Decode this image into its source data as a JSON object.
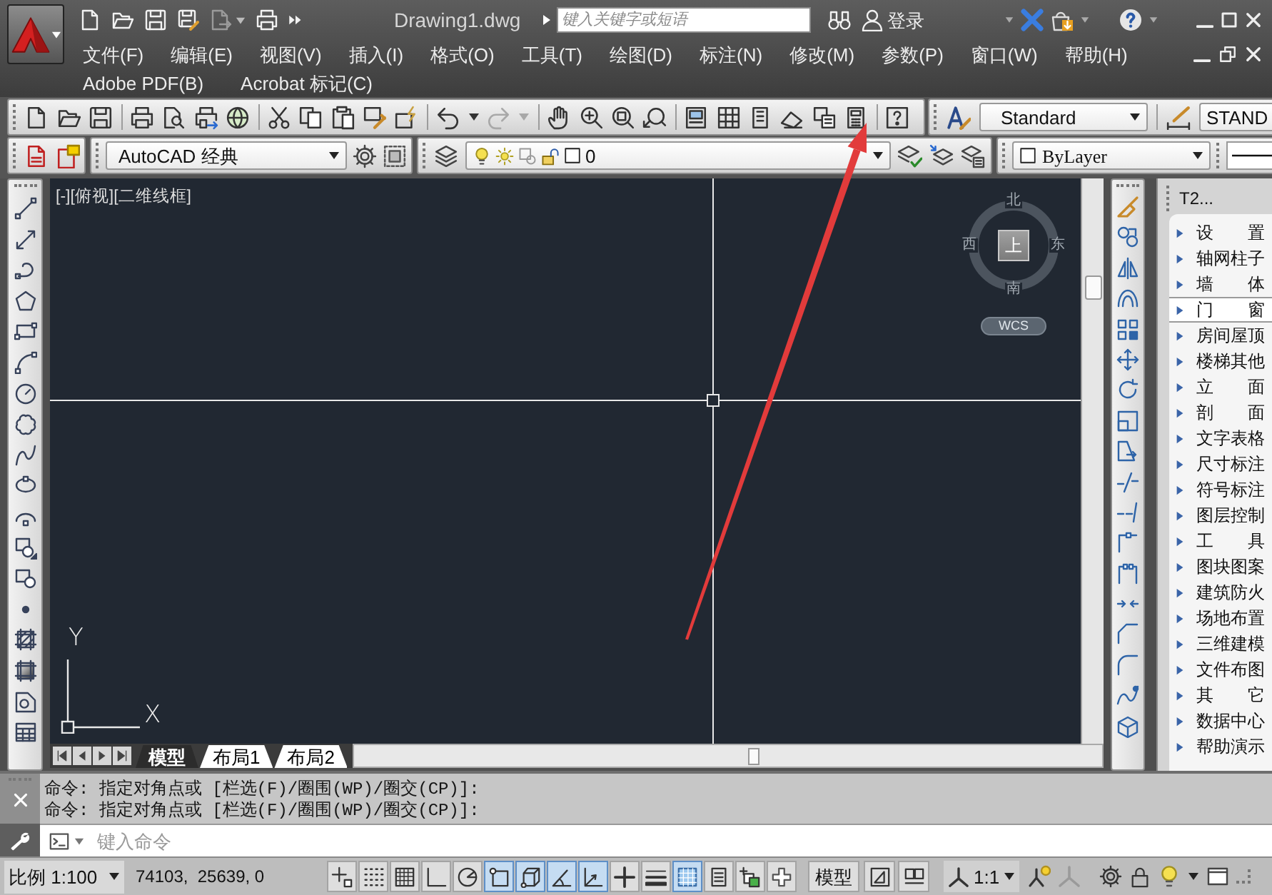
{
  "title_bar": {
    "title": "Drawing1.dwg",
    "search": {
      "placeholder": "键入关键字或短语"
    },
    "sign_in": "登录"
  },
  "menu_bar": [
    "文件(F)",
    "编辑(E)",
    "视图(V)",
    "插入(I)",
    "格式(O)",
    "工具(T)",
    "绘图(D)",
    "标注(N)",
    "修改(M)",
    "参数(P)",
    "窗口(W)",
    "帮助(H)"
  ],
  "menu_bar_2": [
    "Adobe PDF(B)",
    "Acrobat 标记(C)"
  ],
  "styles_toolbar": {
    "text_style": "Standard",
    "dimension_style": "STAND"
  },
  "workspace_toolbar": {
    "workspace": "AutoCAD 经典"
  },
  "layers_toolbar": {
    "layer": "0"
  },
  "properties_toolbar": {
    "color_dropdown": "ByLayer"
  },
  "viewport": {
    "label": "[-][俯视][二维线框]",
    "viewcube": {
      "face": "上",
      "north": "北",
      "south": "南",
      "west": "西",
      "east": "东",
      "coordinate_system": "WCS"
    },
    "ucs_icon": {
      "x_label": "X",
      "y_label": "Y"
    }
  },
  "tool_palette": {
    "title": "T2...",
    "items": [
      {
        "label": "设　　置",
        "selected": false
      },
      {
        "label": "轴网柱子",
        "selected": false
      },
      {
        "label": "墙　　体",
        "selected": false
      },
      {
        "label": "门　　窗",
        "selected": true
      },
      {
        "label": "房间屋顶",
        "selected": false
      },
      {
        "label": "楼梯其他",
        "selected": false
      },
      {
        "label": "立　　面",
        "selected": false
      },
      {
        "label": "剖　　面",
        "selected": false
      },
      {
        "label": "文字表格",
        "selected": false
      },
      {
        "label": "尺寸标注",
        "selected": false
      },
      {
        "label": "符号标注",
        "selected": false
      },
      {
        "label": "图层控制",
        "selected": false
      },
      {
        "label": "工　　具",
        "selected": false
      },
      {
        "label": "图块图案",
        "selected": false
      },
      {
        "label": "建筑防火",
        "selected": false
      },
      {
        "label": "场地布置",
        "selected": false
      },
      {
        "label": "三维建模",
        "selected": false
      },
      {
        "label": "文件布图",
        "selected": false
      },
      {
        "label": "其　　它",
        "selected": false
      },
      {
        "label": "数据中心",
        "selected": false
      },
      {
        "label": "帮助演示",
        "selected": false
      }
    ]
  },
  "layout_tabs": [
    {
      "label": "模型",
      "selected": true
    },
    {
      "label": "布局1",
      "selected": false
    },
    {
      "label": "布局2",
      "selected": false
    }
  ],
  "command_history": [
    "命令: 指定对角点或 [栏选(F)/圈围(WP)/圈交(CP)]:",
    "命令: 指定对角点或 [栏选(F)/圈围(WP)/圈交(CP)]:"
  ],
  "command_input": {
    "placeholder": "键入命令"
  },
  "status_bar": {
    "scale": "比例 1:100",
    "coordinates": "74103,  25639, 0",
    "toggles": [
      {
        "on": false
      },
      {
        "on": false
      },
      {
        "on": false
      },
      {
        "on": false
      },
      {
        "on": false
      },
      {
        "on": true
      },
      {
        "on": true
      },
      {
        "on": true
      },
      {
        "on": true
      },
      {
        "on": false
      },
      {
        "on": false
      },
      {
        "on": true
      },
      {
        "on": false
      },
      {
        "on": false
      },
      {
        "on": false
      }
    ],
    "space": "模型",
    "annotation_scale": "1:1"
  }
}
